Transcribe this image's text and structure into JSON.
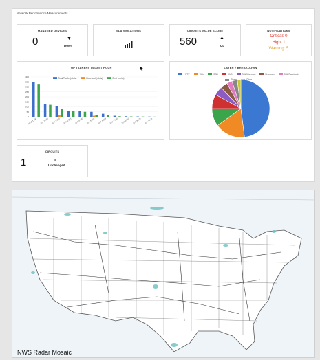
{
  "dashboard": {
    "title": "Network Performance Measurements",
    "managed_devices": {
      "title": "MANAGED DEVICES",
      "value": "0",
      "trend": "Down"
    },
    "sla": {
      "title": "SLA VIOLATIONS"
    },
    "circuits_score": {
      "title": "CIRCUITS VALUE SCORE",
      "value": "560",
      "trend": "Up"
    },
    "notifications": {
      "title": "NOTIFICATIONS",
      "critical": "Critical: 0",
      "high": "High: 1",
      "warning": "Warning: 5"
    },
    "circuits": {
      "title": "CIRCUITS",
      "value": "1",
      "trend": "Unchanged"
    }
  },
  "chart_data": [
    {
      "type": "bar",
      "title": "TOP TALKERS IN LAST HOUR",
      "categories": [
        "10.11.1.140",
        "10.1.2.160",
        "10.1.3.210",
        "10.1.2.201",
        "10.1.4.190",
        "10.1.5.201",
        "10.1.6.203",
        "10.1.7.100",
        "10.1.8.110",
        "10.1.9.120",
        "10.1.10.11"
      ],
      "series": [
        {
          "name": "Total Traffic (mbits)",
          "color": "#3b6fcc",
          "values": [
            350,
            130,
            110,
            60,
            60,
            50,
            30,
            10,
            5,
            3,
            2
          ]
        },
        {
          "name": "Received (mbits)",
          "color": "#f08a24",
          "values": [
            0,
            0,
            20,
            0,
            0,
            10,
            0,
            0,
            0,
            0,
            0
          ]
        },
        {
          "name": "Sent (mbits)",
          "color": "#3aa54a",
          "values": [
            330,
            120,
            80,
            60,
            50,
            20,
            20,
            5,
            3,
            2,
            1
          ]
        }
      ],
      "ylim": [
        0,
        400
      ],
      "yticks": [
        "400",
        "350",
        "300",
        "250",
        "200",
        "150",
        "100",
        "50",
        "0"
      ]
    },
    {
      "type": "pie",
      "title": "LAYER 7 BREAKDOWN",
      "labels": [
        "HTTP",
        "Web",
        "SSH",
        "DNS",
        "SSL/Microsoft",
        "Unknown",
        "SSL/Facebook",
        "Skype",
        "Other"
      ],
      "values": [
        48,
        17,
        10,
        8,
        5,
        4,
        3,
        3,
        2
      ],
      "colors": [
        "#3b78d1",
        "#f08a24",
        "#3aa54a",
        "#cf3030",
        "#8a5cc4",
        "#8a5a44",
        "#e07bbf",
        "#888888",
        "#c8c83a"
      ]
    }
  ],
  "map": {
    "caption": "NWS Radar Mosaic"
  }
}
